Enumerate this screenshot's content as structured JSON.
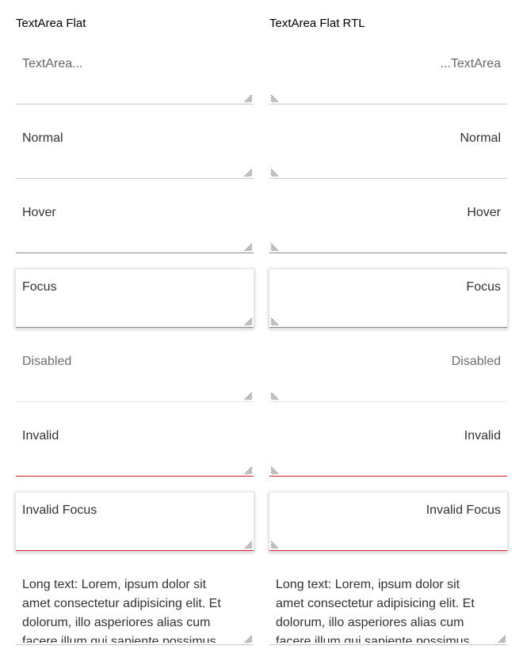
{
  "columns": [
    {
      "title": "TextArea Flat",
      "direction": "ltr",
      "fields": [
        {
          "state": "placeholder",
          "text": "TextArea..."
        },
        {
          "state": "normal",
          "text": "Normal"
        },
        {
          "state": "hover",
          "text": "Hover"
        },
        {
          "state": "focus",
          "text": "Focus"
        },
        {
          "state": "disabled",
          "text": "Disabled"
        },
        {
          "state": "invalid",
          "text": "Invalid"
        },
        {
          "state": "invalid-focus",
          "text": "Invalid Focus"
        },
        {
          "state": "long-text",
          "text": "Long text: Lorem, ipsum dolor sit amet consectetur adipisicing elit. Et dolorum, illo asperiores alias cum facere illum qui sapiente possimus"
        }
      ]
    },
    {
      "title": "TextArea Flat RTL",
      "direction": "rtl",
      "fields": [
        {
          "state": "placeholder",
          "text": "...TextArea"
        },
        {
          "state": "normal",
          "text": "Normal"
        },
        {
          "state": "hover",
          "text": "Hover"
        },
        {
          "state": "focus",
          "text": "Focus"
        },
        {
          "state": "disabled",
          "text": "Disabled"
        },
        {
          "state": "invalid",
          "text": "Invalid"
        },
        {
          "state": "invalid-focus",
          "text": "Invalid Focus"
        },
        {
          "state": "long-text",
          "text": "Long text: Lorem, ipsum dolor sit amet consectetur adipisicing elit. Et dolorum, illo asperiores alias cum facere illum qui sapiente possimus"
        }
      ]
    }
  ],
  "colors": {
    "border": "#c8c8c8",
    "border_hover": "#8a8a8a",
    "border_invalid": "#d51923",
    "text": "#333333",
    "text_disabled": "#6e6e6e"
  },
  "icons": {
    "resize_grip": "resize-grip-icon"
  }
}
